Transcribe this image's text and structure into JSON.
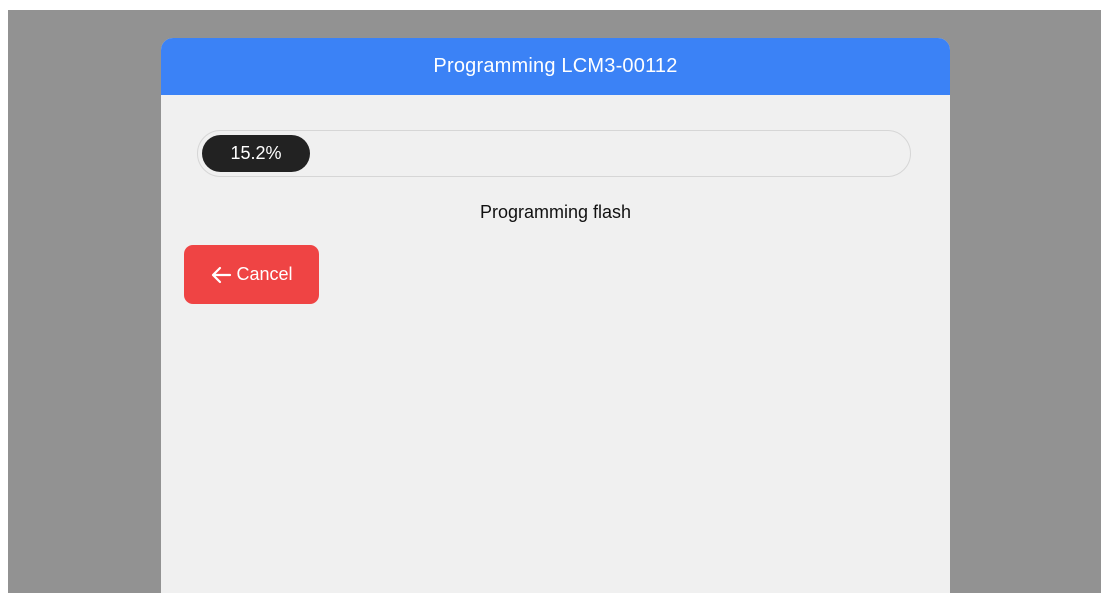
{
  "dialog": {
    "title": "Programming LCM3-00112",
    "header_color": "#3b82f6"
  },
  "progress": {
    "value_percent": 15.2,
    "label": "15.2%"
  },
  "status": {
    "text": "Programming flash"
  },
  "cancel_button": {
    "label": "Cancel",
    "icon": "arrow-left-icon",
    "color": "#ef4444"
  }
}
